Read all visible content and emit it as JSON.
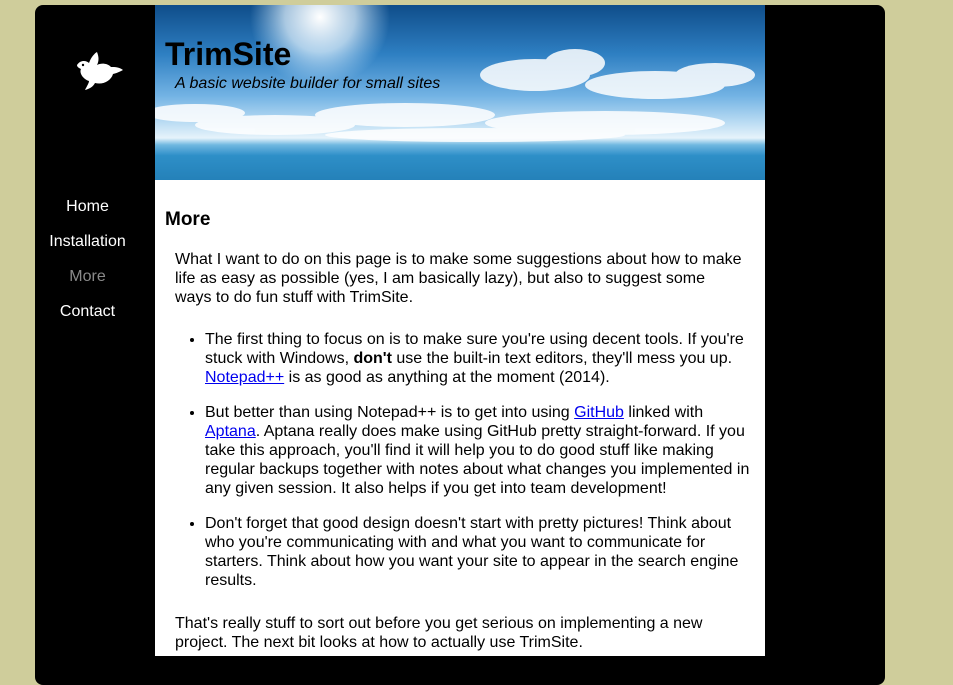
{
  "sidebar": {
    "logo_icon": "dove-icon",
    "nav": [
      {
        "label": "Home",
        "current": false
      },
      {
        "label": "Installation",
        "current": false
      },
      {
        "label": "More",
        "current": true
      },
      {
        "label": "Contact",
        "current": false
      }
    ]
  },
  "header": {
    "title": "TrimSite",
    "tagline": "A basic website builder for small sites"
  },
  "content": {
    "heading": "More",
    "intro": "What I want to do on this page is to make some suggestions about how to make life as easy as possible (yes, I am basically lazy), but also to suggest some ways to do fun stuff with TrimSite.",
    "bullet1": {
      "part1": "The first thing to focus on is to make sure you're using decent tools. If you're stuck with Windows, ",
      "strong": "don't",
      "part2": " use the built-in text editors, they'll mess you up. ",
      "link": "Notepad++",
      "part3": " is as good as anything at the moment (2014)."
    },
    "bullet2": {
      "part1": "But better than using Notepad++ is to get into using ",
      "link1": "GitHub",
      "part2": " linked with ",
      "link2": "Aptana",
      "part3": ". Aptana really does make using GitHub pretty straight-forward. If you take this approach, you'll find it will help you to do good stuff like making regular backups together with notes about what changes you implemented in any given session. It also helps if you get into team development!"
    },
    "bullet3": "Don't forget that good design doesn't start with pretty pictures! Think about who you're communicating with and what you want to communicate for starters. Think about how you want your site to appear in the search engine results.",
    "outro": "That's really stuff to sort out before you get serious on implementing a new project. The next bit looks at how to actually use TrimSite."
  },
  "colors": {
    "page_background": "#cfcd9b",
    "frame": "#000000",
    "nav_text": "#ffffff",
    "nav_current": "#8a8a8a",
    "link": "#0000ee"
  }
}
